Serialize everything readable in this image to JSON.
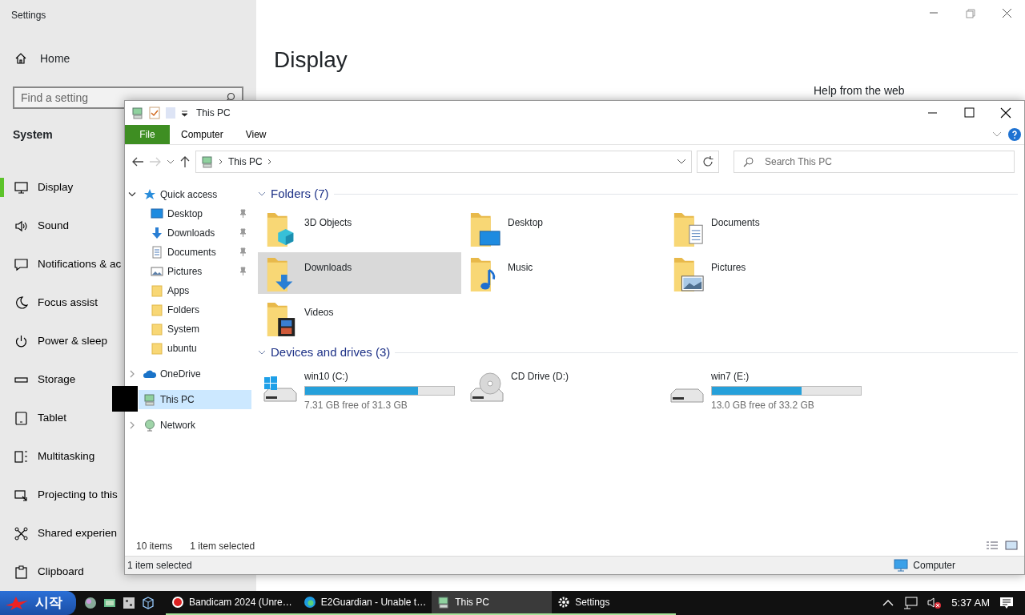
{
  "settings": {
    "title": "Settings",
    "home": "Home",
    "search": {
      "placeholder": "Find a setting"
    },
    "section": "System",
    "nav": [
      {
        "label": "Display",
        "kind": "display",
        "selected": true
      },
      {
        "label": "Sound",
        "kind": "sound",
        "selected": false
      },
      {
        "label": "Notifications & ac",
        "kind": "notifications",
        "selected": false
      },
      {
        "label": "Focus assist",
        "kind": "focus",
        "selected": false
      },
      {
        "label": "Power & sleep",
        "kind": "power",
        "selected": false
      },
      {
        "label": "Storage",
        "kind": "storage",
        "selected": false
      },
      {
        "label": "Tablet",
        "kind": "tablet",
        "selected": false
      },
      {
        "label": "Multitasking",
        "kind": "multitasking",
        "selected": false
      },
      {
        "label": "Projecting to this",
        "kind": "projecting",
        "selected": false
      },
      {
        "label": "Shared experien",
        "kind": "shared",
        "selected": false
      },
      {
        "label": "Clipboard",
        "kind": "clipboard",
        "selected": false
      }
    ],
    "page_title": "Display",
    "help_title": "Help from the web"
  },
  "explorer": {
    "title": "This PC",
    "ribbon_tabs": [
      {
        "label": "File",
        "kind": "file"
      },
      {
        "label": "Computer",
        "kind": "tab"
      },
      {
        "label": "View",
        "kind": "tab"
      }
    ],
    "address": {
      "path": [
        "This PC"
      ]
    },
    "search": {
      "placeholder": "Search This PC"
    },
    "tree": [
      {
        "label": "Quick access",
        "kind": "quick",
        "expanded": true,
        "selected": false,
        "children": [
          {
            "label": "Desktop",
            "kind": "desktop",
            "pinned": true,
            "selected": false
          },
          {
            "label": "Downloads",
            "kind": "downloads",
            "pinned": true,
            "selected": false
          },
          {
            "label": "Documents",
            "kind": "documents",
            "pinned": true,
            "selected": false
          },
          {
            "label": "Pictures",
            "kind": "pictures",
            "pinned": true,
            "selected": false
          },
          {
            "label": "Apps",
            "kind": "folder",
            "pinned": false,
            "selected": false
          },
          {
            "label": "Folders",
            "kind": "folder",
            "pinned": false,
            "selected": false
          },
          {
            "label": "System",
            "kind": "folder",
            "pinned": false,
            "selected": false
          },
          {
            "label": "ubuntu",
            "kind": "folder",
            "pinned": false,
            "selected": false
          }
        ]
      },
      {
        "label": "OneDrive",
        "kind": "cloud",
        "expanded": false,
        "selected": false
      },
      {
        "label": "This PC",
        "kind": "pc",
        "selected": true
      },
      {
        "label": "Network",
        "kind": "network",
        "expanded": false,
        "selected": false
      }
    ],
    "folders": {
      "header": "Folders (7)",
      "items": [
        {
          "name": "3D Objects",
          "kind": "objects3d",
          "selected": false
        },
        {
          "name": "Desktop",
          "kind": "desktop",
          "selected": false
        },
        {
          "name": "Documents",
          "kind": "documents",
          "selected": false
        },
        {
          "name": "Downloads",
          "kind": "downloads",
          "selected": true
        },
        {
          "name": "Music",
          "kind": "music",
          "selected": false
        },
        {
          "name": "Pictures",
          "kind": "pictures",
          "selected": false
        },
        {
          "name": "Videos",
          "kind": "videos",
          "selected": false
        }
      ]
    },
    "drives": {
      "header": "Devices and drives (3)",
      "items": [
        {
          "name": "win10 (C:)",
          "kind": "system",
          "level": 0.76,
          "free": "7.31 GB free of 31.3 GB"
        },
        {
          "name": "CD Drive (D:)",
          "kind": "cd"
        },
        {
          "name": "win7 (E:)",
          "kind": "disk",
          "level": 0.6,
          "free": "13.0 GB free of 33.2 GB"
        }
      ]
    },
    "status": {
      "count": "10 items",
      "selection": "1 item selected"
    },
    "details_bar": {
      "text": "1 item selected",
      "location": "Computer"
    }
  },
  "taskbar": {
    "start": "시작",
    "tasks": [
      {
        "label": "Bandicam 2024 (Unre…",
        "kind": "record",
        "selected": false
      },
      {
        "label": "E2Guardian - Unable t…",
        "kind": "browser",
        "selected": false
      },
      {
        "label": "This PC",
        "kind": "pc",
        "selected": true
      },
      {
        "label": "Settings",
        "kind": "settings",
        "selected": false
      }
    ],
    "clock": "5:37 AM"
  }
}
